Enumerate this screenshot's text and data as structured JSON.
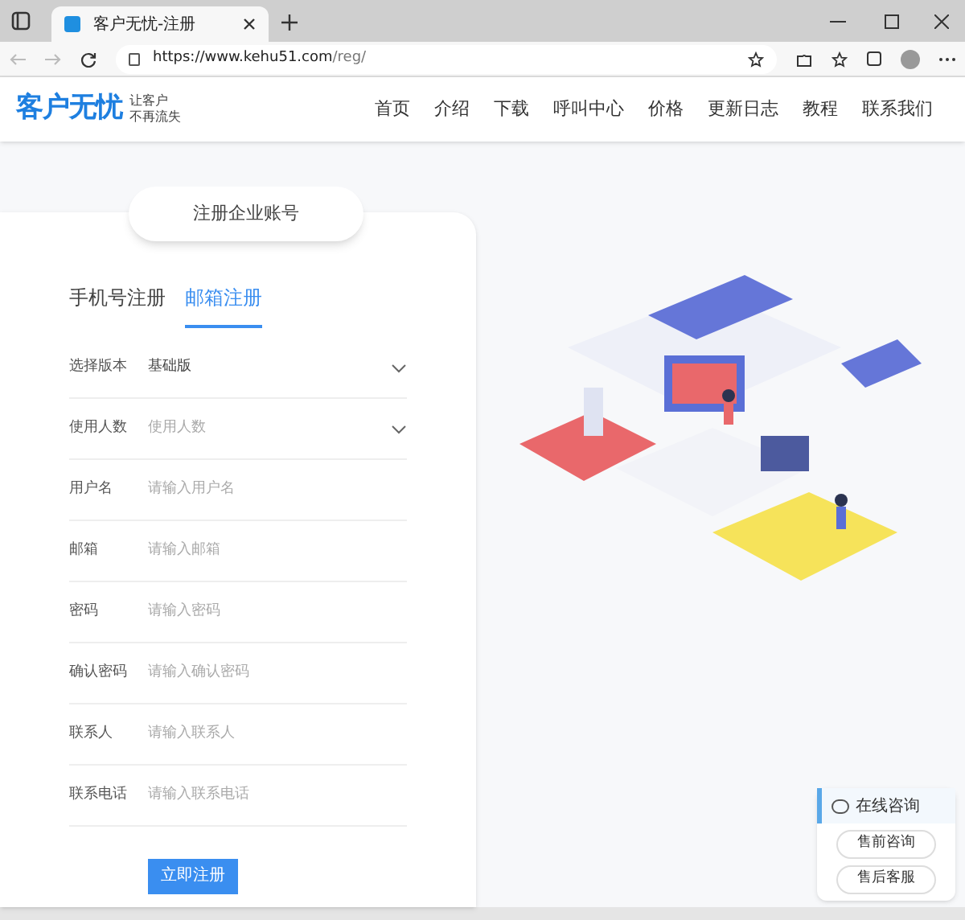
{
  "browser": {
    "tab_title": "客户无忧-注册",
    "url_host": "https://www.kehu51.com",
    "url_path": "/reg/"
  },
  "site": {
    "logo": "客户无忧",
    "slogan_1": "让客户",
    "slogan_2": "不再流失",
    "nav": [
      {
        "label": "首页"
      },
      {
        "label": "介绍"
      },
      {
        "label": "下载"
      },
      {
        "label": "呼叫中心"
      },
      {
        "label": "价格"
      },
      {
        "label": "更新日志"
      },
      {
        "label": "教程"
      },
      {
        "label": "联系我们"
      }
    ]
  },
  "form": {
    "title": "注册企业账号",
    "tabs": [
      {
        "label": "手机号注册",
        "selected": false
      },
      {
        "label": "邮箱注册",
        "selected": true
      }
    ],
    "fields": [
      {
        "kind": "select",
        "label": "选择版本",
        "value": "基础版"
      },
      {
        "kind": "select",
        "label": "使用人数",
        "placeholder": "使用人数"
      },
      {
        "kind": "input",
        "label": "用户名",
        "placeholder": "请输入用户名"
      },
      {
        "kind": "input",
        "label": "邮箱",
        "placeholder": "请输入邮箱"
      },
      {
        "kind": "input",
        "label": "密码",
        "placeholder": "请输入密码"
      },
      {
        "kind": "input",
        "label": "确认密码",
        "placeholder": "请输入确认密码"
      },
      {
        "kind": "input",
        "label": "联系人",
        "placeholder": "请输入联系人"
      },
      {
        "kind": "input",
        "label": "联系电话",
        "placeholder": "请输入联系电话"
      }
    ],
    "submit": "立即注册"
  },
  "chat": {
    "title": "在线咨询",
    "buttons": [
      "售前咨询",
      "售后客服"
    ]
  }
}
